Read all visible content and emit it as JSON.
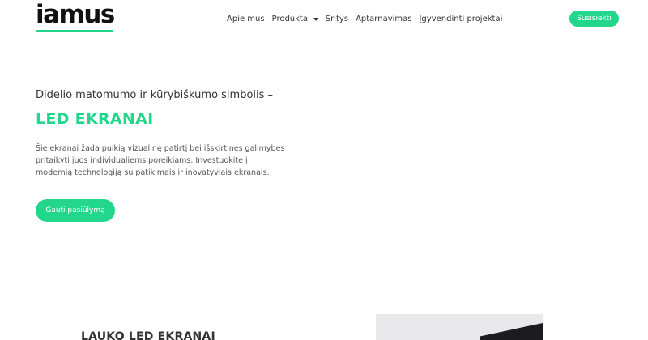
{
  "header": {
    "logo_text": "iamus",
    "nav": [
      {
        "label": "Apie mus",
        "has_dropdown": false
      },
      {
        "label": "Produktai",
        "has_dropdown": true
      },
      {
        "label": "Sritys",
        "has_dropdown": false
      },
      {
        "label": "Aptarnavimas",
        "has_dropdown": false
      },
      {
        "label": "Įgyvendinti projektai",
        "has_dropdown": false
      }
    ],
    "contact_label": "Susisiekti"
  },
  "hero": {
    "subtitle": "Didelio matomumo ir kūrybiškumo simbolis –",
    "title": "LED EKRANAI",
    "description_lines": [
      "Šie ekranai žada puikią vizualinę patirtį bei išskirtines galimybes",
      "pritaikyti juos individualiems poreikiams. Investuokite į",
      "modernią technologiją su patikimais ir inovatyviais ekranais."
    ],
    "cta_label": "Gauti pasiūlymą"
  },
  "next_section": {
    "heading": "LAUKO LED EKRANAI"
  },
  "colors": {
    "accent": "#22d68b",
    "text": "#333333",
    "logo": "#111111"
  }
}
